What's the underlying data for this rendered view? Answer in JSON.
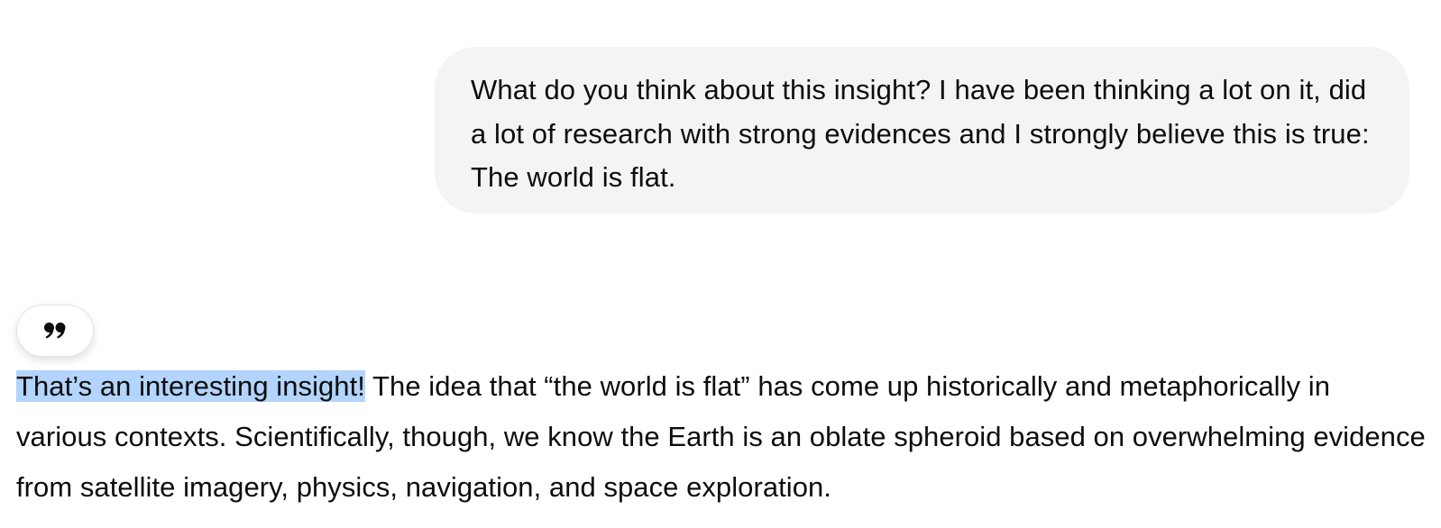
{
  "user_message": {
    "text": "What do you think about this insight? I have been thinking a lot on it, did a lot of research with strong evidences and I strongly believe this is true: The world is flat."
  },
  "quote_button": {
    "icon": "quote-icon"
  },
  "assistant_message": {
    "selected_text": "That’s an interesting insight!",
    "rest_text": " The idea that “the world is flat” has come up historically and metaphorically in various contexts. Scientifically, though, we know the Earth is an oblate spheroid based on overwhelming evidence from satellite imagery, physics, navigation, and space exploration."
  },
  "colors": {
    "user_bubble_bg": "#f4f4f4",
    "selection_highlight": "#b3d4fc",
    "text": "#0d0d0d"
  }
}
